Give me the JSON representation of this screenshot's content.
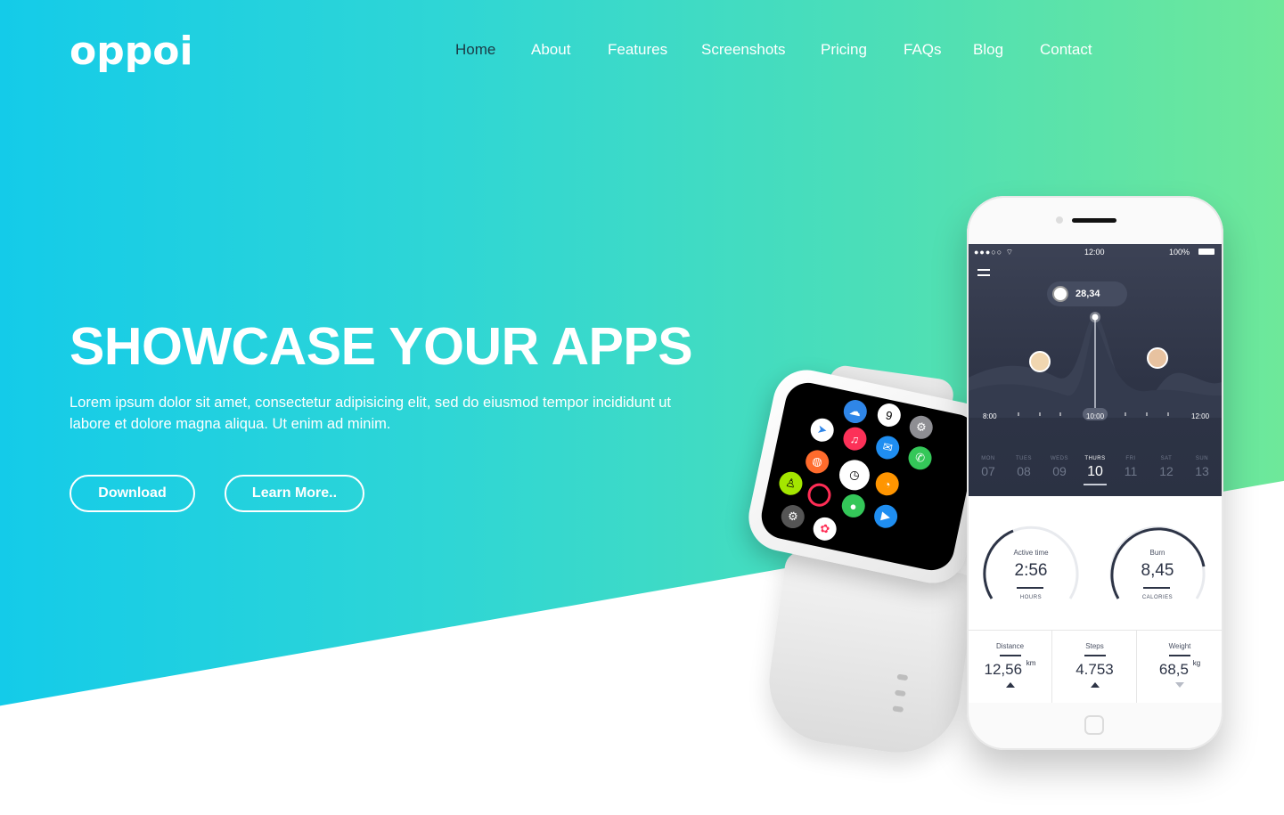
{
  "brand": {
    "logo_text": "oppoi"
  },
  "nav": {
    "items": [
      {
        "label": "Home",
        "active": true
      },
      {
        "label": "About"
      },
      {
        "label": "Features"
      },
      {
        "label": "Screenshots"
      },
      {
        "label": "Pricing"
      },
      {
        "label": "FAQs"
      },
      {
        "label": "Blog"
      },
      {
        "label": "Contact"
      }
    ]
  },
  "hero": {
    "headline": "SHOWCASE YOUR APPS",
    "lead": "Lorem ipsum dolor sit amet, consectetur adipisicing elit, sed do eiusmod tempor incididunt ut labore et dolore magna aliqua. Ut enim ad minim.",
    "download_label": "Download",
    "learn_more_label": "Learn More.."
  },
  "colors": {
    "gradient_start": "#14cbe9",
    "gradient_end": "#6ee89a",
    "active_nav": "#1c3a45",
    "phone_dark": "#2e3446"
  },
  "phone": {
    "status": {
      "time": "12:00",
      "battery": "100%"
    },
    "distance_pill": "28,34",
    "timeline": {
      "start": "8:00",
      "current": "10:00",
      "end": "12:00"
    },
    "days": [
      {
        "d": "MON",
        "n": "07"
      },
      {
        "d": "TUES",
        "n": "08"
      },
      {
        "d": "WEDS",
        "n": "09"
      },
      {
        "d": "THURS",
        "n": "10",
        "active": true
      },
      {
        "d": "FRI",
        "n": "11"
      },
      {
        "d": "SAT",
        "n": "12"
      },
      {
        "d": "SUN",
        "n": "13"
      }
    ],
    "gauges": [
      {
        "label": "Active time",
        "value": "2:56",
        "unit": "HOURS",
        "progress": 0.35
      },
      {
        "label": "Burn",
        "value": "8,45",
        "unit": "CALORIES",
        "progress": 0.7
      }
    ],
    "stats": [
      {
        "title": "Distance",
        "value": "12,56",
        "unit": "km",
        "trend": "up"
      },
      {
        "title": "Steps",
        "value": "4.753",
        "unit": "",
        "trend": "up"
      },
      {
        "title": "Weight",
        "value": "68,5",
        "unit": "kg",
        "trend": "down"
      }
    ]
  },
  "watch": {
    "apps": [
      "weather-icon",
      "clock-icon",
      "settings-icon",
      "maps-icon",
      "music-icon",
      "mail-icon",
      "phone-icon",
      "globe-icon",
      "watch-face-icon",
      "timer-icon",
      "workout-icon",
      "activity-icon",
      "messages-icon",
      "remote-icon",
      "photos-icon",
      "passbook-icon"
    ]
  }
}
